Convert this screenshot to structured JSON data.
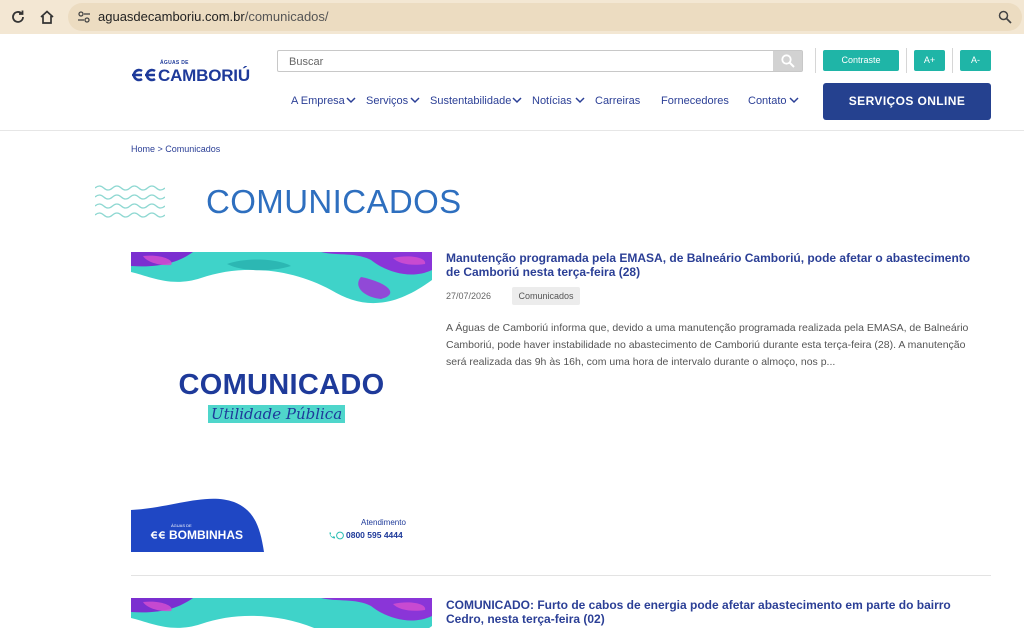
{
  "browser": {
    "url_domain": "aguasdecamboriu.com.br",
    "url_path": "/comunicados/"
  },
  "header": {
    "logo_small": "ÁGUAS DE",
    "logo_text": "CAMBORIÚ",
    "search_placeholder": "Buscar",
    "contrast_label": "Contraste",
    "font_plus_label": "A+",
    "font_minus_label": "A-",
    "services_button": "SERVIÇOS ONLINE",
    "nav": [
      {
        "label": "A Empresa",
        "dropdown": true
      },
      {
        "label": "Serviços",
        "dropdown": true
      },
      {
        "label": "Sustentabilidade",
        "dropdown": true
      },
      {
        "label": "Notícias",
        "dropdown": true
      },
      {
        "label": "Carreiras",
        "dropdown": false
      },
      {
        "label": "Fornecedores",
        "dropdown": false
      },
      {
        "label": "Contato",
        "dropdown": true
      }
    ]
  },
  "breadcrumb": "Home > Comunicados",
  "page_title": "COMUNICADOS",
  "thumbnail": {
    "heading": "COMUNICADO",
    "subheading": "Utilidade Pública",
    "brand_small": "ÁGUAS DE",
    "brand": "BOMBINHAS",
    "support_label": "Atendimento",
    "phone": "0800 595 4444"
  },
  "news": [
    {
      "title": "Manutenção programada pela EMASA, de Balneário Camboriú, pode afetar o abastecimento de Camboriú nesta terça-feira (28)",
      "date": "27/07/2026",
      "tag": "Comunicados",
      "excerpt": "  A Águas de Camboriú informa que, devido a uma manutenção programada realizada pela EMASA, de Balneário Camboriú, pode haver instabilidade no abastecimento de Camboriú durante esta terça-feira (28). A manutenção será realizada das 9h às 16h, com uma hora de intervalo durante o almoço, nos p..."
    },
    {
      "title": "COMUNICADO: Furto de cabos de energia pode afetar abastecimento em parte do bairro Cedro, nesta terça-feira (02)"
    }
  ],
  "colors": {
    "brand_blue": "#1e3a9a",
    "nav_blue": "#2b3f96",
    "teal": "#1fb5a7",
    "title_blue": "#2e6fbf",
    "services_bg": "#25418f"
  }
}
